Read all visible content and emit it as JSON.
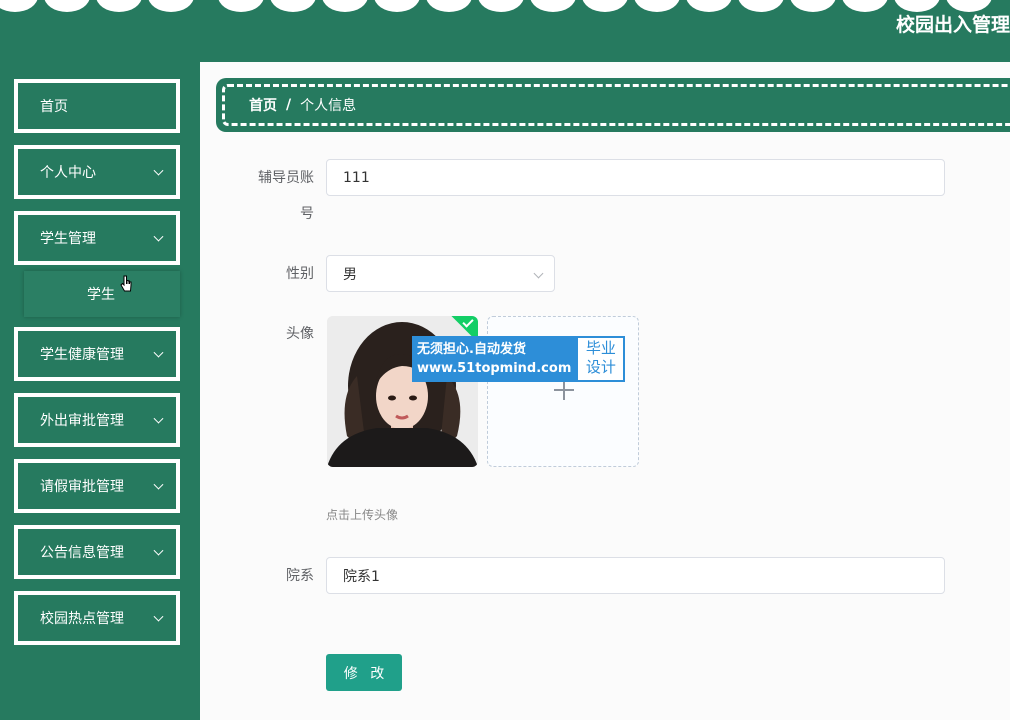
{
  "header": {
    "title": "校园出入管理"
  },
  "sidebar": {
    "items": [
      {
        "label": "首页",
        "expandable": false
      },
      {
        "label": "个人中心",
        "expandable": true
      },
      {
        "label": "学生管理",
        "expandable": true
      },
      {
        "label": "学生健康管理",
        "expandable": true
      },
      {
        "label": "外出审批管理",
        "expandable": true
      },
      {
        "label": "请假审批管理",
        "expandable": true
      },
      {
        "label": "公告信息管理",
        "expandable": true
      },
      {
        "label": "校园热点管理",
        "expandable": true
      }
    ],
    "sub_item": {
      "label": "学生"
    }
  },
  "breadcrumb": {
    "home": "首页",
    "separator": "/",
    "current": "个人信息"
  },
  "form": {
    "account": {
      "label_line1": "辅导员账",
      "label_line2": "号",
      "value": "111"
    },
    "gender": {
      "label": "性别",
      "value": "男"
    },
    "avatar": {
      "label": "头像",
      "upload_hint": "点击上传头像"
    },
    "department": {
      "label": "院系",
      "value": "院系1"
    },
    "submit_label": "修 改"
  },
  "watermark": {
    "line1": "无须担心.自动发货",
    "line2": "www.51topmind.com",
    "badge_line1": "毕业",
    "badge_line2": "设计"
  },
  "colors": {
    "primary": "#267a5f",
    "button": "#20a08a",
    "success": "#13ce66"
  }
}
